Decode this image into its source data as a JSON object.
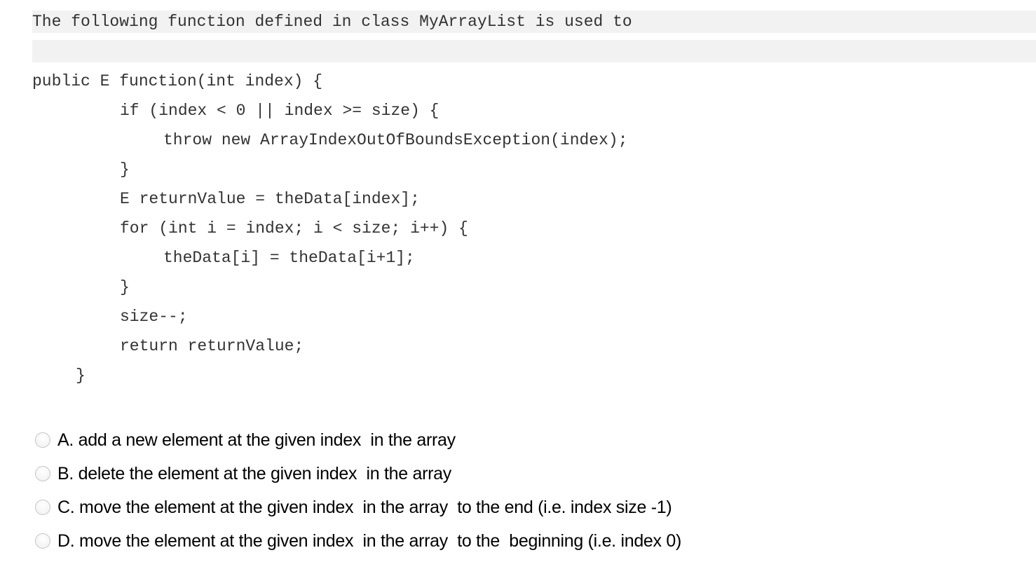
{
  "question": {
    "prompt": "The following function defined in class MyArrayList is used to",
    "code_lines": [
      "public E function(int index) {",
      "if (index < 0 || index >= size) {",
      "throw new ArrayIndexOutOfBoundsException(index);",
      "}",
      "E returnValue = theData[index];",
      "for (int i = index; i < size; i++) {",
      "theData[i] = theData[i+1];",
      "}",
      "size--;",
      "return returnValue;",
      "}"
    ]
  },
  "options": [
    {
      "label": "A. add a new element at the given index  in the array",
      "selected": false
    },
    {
      "label": "B. delete the element at the given index  in the array",
      "selected": false
    },
    {
      "label": "C. move the element at the given index  in the array  to the end (i.e. index size -1)",
      "selected": false
    },
    {
      "label": "D. move the element at the given index  in the array  to the  beginning (i.e. index 0)",
      "selected": false
    }
  ]
}
